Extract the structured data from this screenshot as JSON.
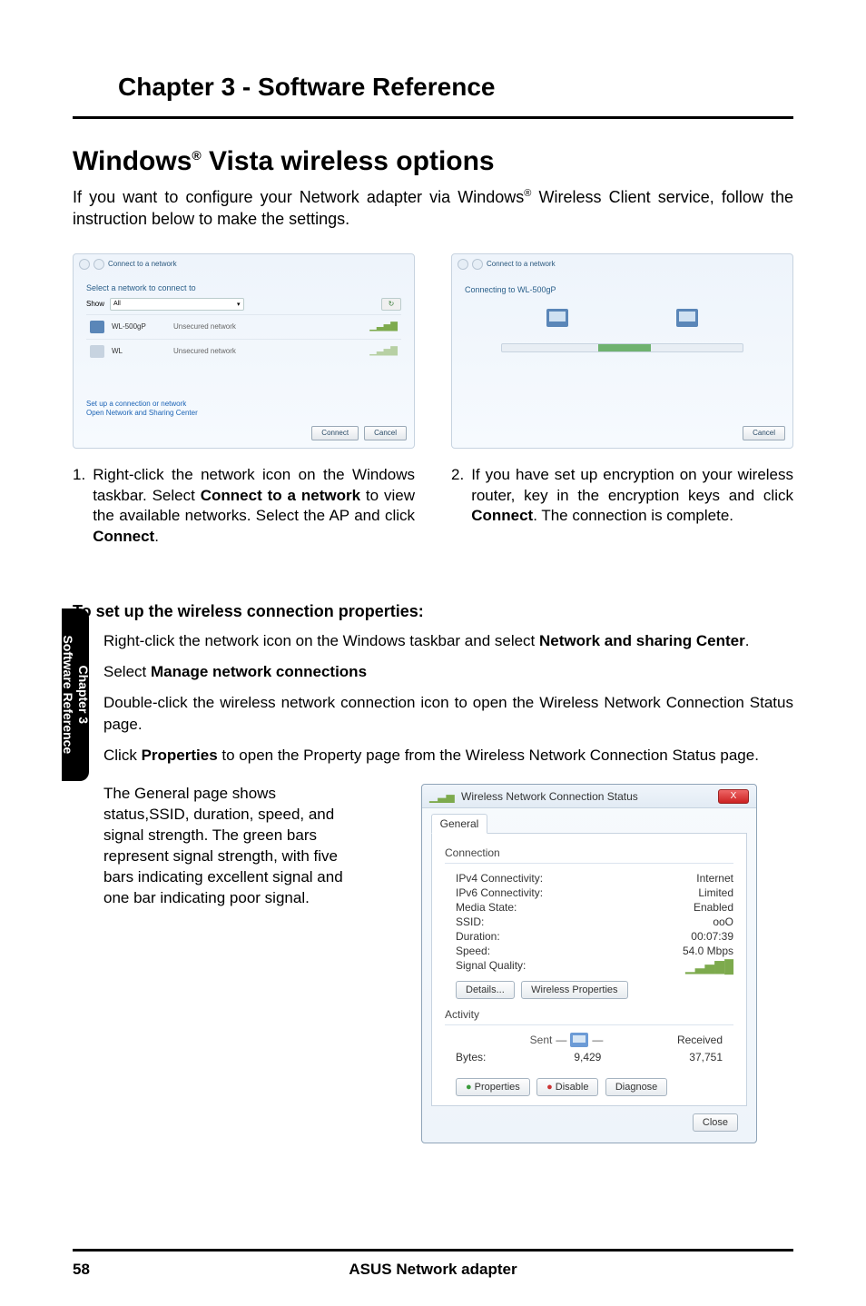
{
  "header": {
    "chapter_title": "Chapter 3 - Software Reference"
  },
  "side_tab": {
    "line1": "Chapter 3",
    "line2": "Software Reference"
  },
  "section": {
    "title_prefix": "Windows",
    "title_reg": "®",
    "title_suffix": " Vista wireless options",
    "intro_a": "If you want to configure your Network adapter via Windows",
    "intro_reg": "®",
    "intro_b": " Wireless Client service, follow the instruction below to make the settings."
  },
  "screenshots": {
    "nav_left": "Connect to a network",
    "nav_right": "Connect to a network",
    "select_heading": "Select a network to connect to",
    "connecting_heading": "Connecting to WL-500gP",
    "show_label": "Show",
    "show_value": "All",
    "refresh_label": "↻",
    "net1_name": "WL-500gP",
    "net1_status": "Unsecured network",
    "net2_name": "WL",
    "net2_status": "Unsecured network",
    "link1": "Set up a connection or network",
    "link2": "Open Network and Sharing Center",
    "btn_connect": "Connect",
    "btn_cancel": "Cancel"
  },
  "steps_top": {
    "s1_num": "1.",
    "s1_text_a": "Right-click the network icon on the Windows taskbar. Select ",
    "s1_bold1": "Connect to a network",
    "s1_text_b": " to view the available networks. Select the AP and click ",
    "s1_bold2": "Connect",
    "s1_text_c": ".",
    "s2_num": "2.",
    "s2_text_a": "If you have set up encryption on your wireless router, key in the encryption keys and click ",
    "s2_bold1": "Connect",
    "s2_text_b": ". The connection is complete."
  },
  "props": {
    "heading": "To set up the wireless connection properties:",
    "items": [
      {
        "a": "Right-click the network icon on the Windows taskbar and select ",
        "b": "Network and sharing Center",
        "c": "."
      },
      {
        "a": "Select ",
        "b": "Manage network connections",
        "c": "."
      },
      {
        "a": "Double-click the wireless network connection icon to open the Wireless Network Connection Status page.",
        "b": "",
        "c": ""
      },
      {
        "a": "Click ",
        "b": "Properties",
        "c": " to open the Property page from the Wireless Network Connection Status page."
      }
    ],
    "general_paragraph": "The General page shows status,SSID, duration, speed, and signal strength. The green bars represent signal strength, with five bars indicating excellent signal and one bar indicating poor signal."
  },
  "status_dialog": {
    "title": "Wireless Network Connection Status",
    "close_glyph": "X",
    "tab_general": "General",
    "group_connection": "Connection",
    "kv": [
      {
        "k": "IPv4 Connectivity:",
        "v": "Internet"
      },
      {
        "k": "IPv6 Connectivity:",
        "v": "Limited"
      },
      {
        "k": "Media State:",
        "v": "Enabled"
      },
      {
        "k": "SSID:",
        "v": "ooO"
      },
      {
        "k": "Duration:",
        "v": "00:07:39"
      },
      {
        "k": "Speed:",
        "v": "54.0 Mbps"
      }
    ],
    "signal_label": "Signal Quality:",
    "btn_details": "Details...",
    "btn_wprops": "Wireless Properties",
    "group_activity": "Activity",
    "sent_label": "Sent",
    "received_label": "Received",
    "bytes_label": "Bytes:",
    "bytes_sent": "9,429",
    "bytes_recv": "37,751",
    "btn_props": "Properties",
    "btn_disable": "Disable",
    "btn_diagnose": "Diagnose",
    "btn_close": "Close"
  },
  "footer": {
    "page": "58",
    "product": "ASUS Network adapter"
  }
}
